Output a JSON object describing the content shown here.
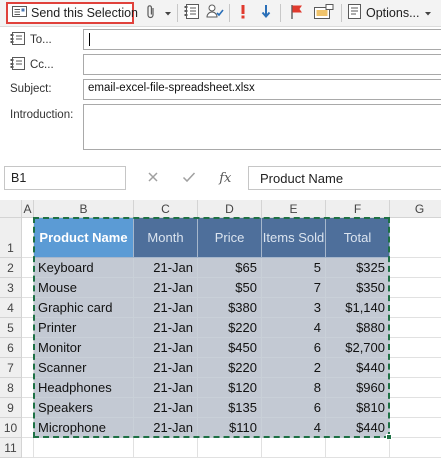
{
  "toolbar": {
    "send_selection_label": "Send this Selection",
    "options_label": "Options..."
  },
  "form": {
    "to_label": "To...",
    "cc_label": "Cc...",
    "subject_label": "Subject:",
    "subject_value": "email-excel-file-spreadsheet.xlsx",
    "introduction_label": "Introduction:",
    "to_value": "",
    "cc_value": "",
    "introduction_value": ""
  },
  "formula_bar": {
    "name_box": "B1",
    "fx_label": "fx",
    "formula": "Product Name"
  },
  "sheet": {
    "columns": [
      "A",
      "B",
      "C",
      "D",
      "E",
      "F",
      "G"
    ],
    "rows": [
      "1",
      "2",
      "3",
      "4",
      "5",
      "6",
      "7",
      "8",
      "9",
      "10",
      "11"
    ],
    "table": {
      "headers": [
        "Product Name",
        "Month",
        "Price",
        "Items Sold",
        "Total"
      ],
      "rows": [
        [
          "Keyboard",
          "21-Jan",
          "$65",
          "5",
          "$325"
        ],
        [
          "Mouse",
          "21-Jan",
          "$50",
          "7",
          "$350"
        ],
        [
          "Graphic card",
          "21-Jan",
          "$380",
          "3",
          "$1,140"
        ],
        [
          "Printer",
          "21-Jan",
          "$220",
          "4",
          "$880"
        ],
        [
          "Monitor",
          "21-Jan",
          "$450",
          "6",
          "$2,700"
        ],
        [
          "Scanner",
          "21-Jan",
          "$220",
          "2",
          "$440"
        ],
        [
          "Headphones",
          "21-Jan",
          "$120",
          "8",
          "$960"
        ],
        [
          "Speakers",
          "21-Jan",
          "$135",
          "6",
          "$810"
        ],
        [
          "Microphone",
          "21-Jan",
          "$110",
          "4",
          "$440"
        ]
      ]
    }
  },
  "colors": {
    "header_active": "#5b9bd5",
    "header_inactive": "#4e6f9b",
    "row_fill": "#c3c9d3",
    "selection_border": "#1e7145",
    "send_button_highlight": "#e0413b"
  }
}
